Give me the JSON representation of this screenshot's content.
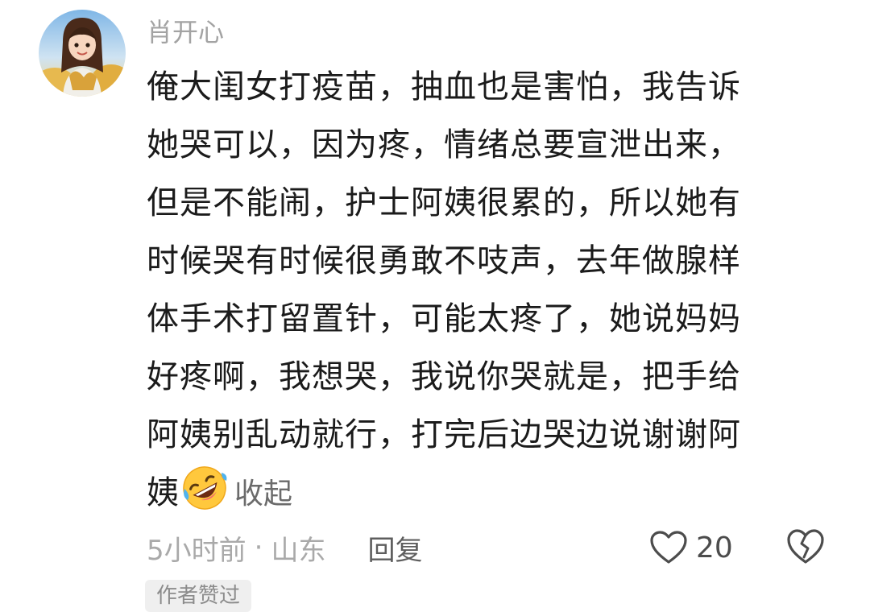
{
  "comment": {
    "username": "肖开心",
    "avatar_icon": "avatar-girl-wheat-field",
    "lines": [
      "俺大闺女打疫苗，抽血也是害怕，我告诉",
      "她哭可以，因为疼，情绪总要宣泄出来，",
      "但是不能闹，护士阿姨很累的，所以她有",
      "时候哭有时候很勇敢不吱声，去年做腺样",
      "体手术打留置针，可能太疼了，她说妈妈",
      "好疼啊，我想哭，我说你哭就是，把手给",
      "阿姨别乱动就行，打完后边哭边说谢谢阿",
      "姨"
    ],
    "emoji_icon": "rolling-on-floor-laughing-emoji",
    "collapse_label": "收起",
    "time": "5小时前",
    "separator": "·",
    "location": "山东",
    "reply_label": "回复",
    "like_count": "20",
    "author_tag": "作者赞过"
  },
  "colors": {
    "username": "#a3a3a3",
    "body_text": "#1b1b1b",
    "meta_text": "#a9a9a9",
    "reply_text": "#5e5e5e",
    "icon_stroke": "#4c4c4c"
  }
}
